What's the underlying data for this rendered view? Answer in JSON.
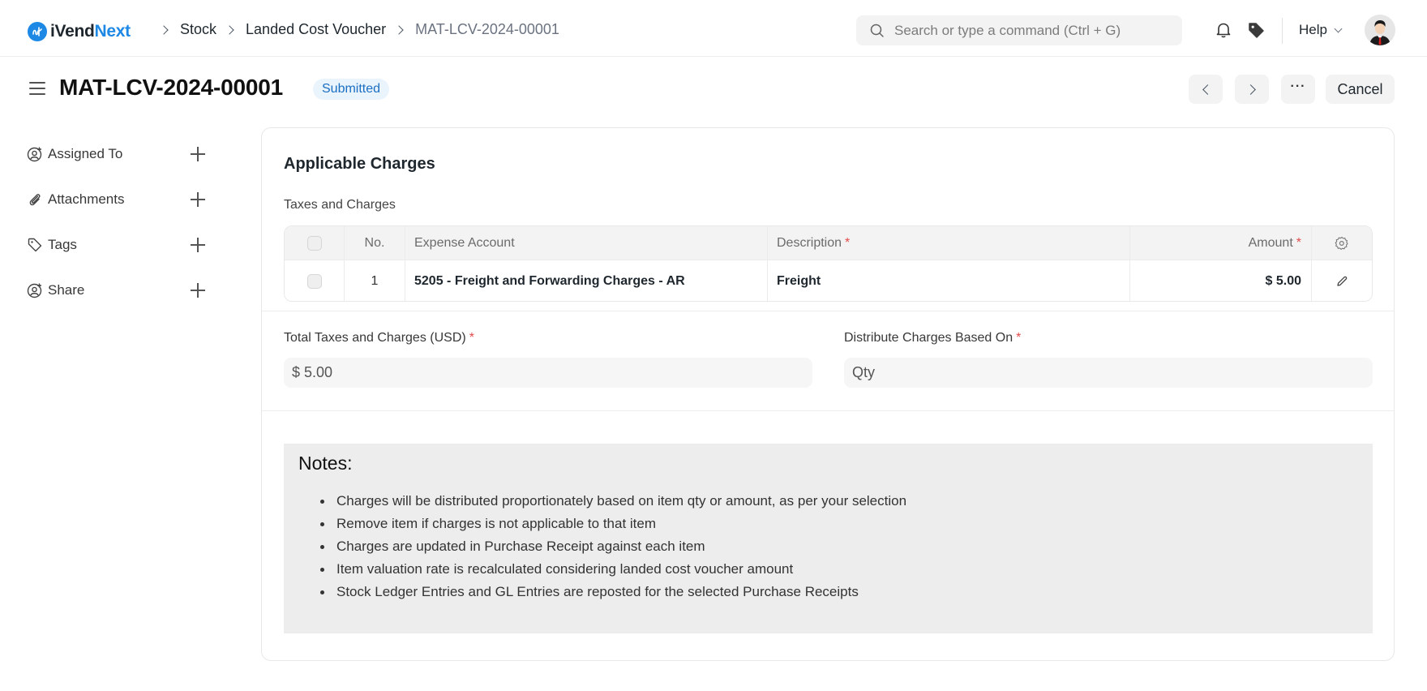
{
  "app": {
    "name_part1": "iVend",
    "name_part2": "Next",
    "brand_color": "#1e88e5"
  },
  "breadcrumb": [
    {
      "label": "Stock"
    },
    {
      "label": "Landed Cost Voucher"
    },
    {
      "label": "MAT-LCV-2024-00001"
    }
  ],
  "search": {
    "placeholder": "Search or type a command (Ctrl + G)",
    "icon": "search-icon"
  },
  "navbar": {
    "notifications_icon": "bell-icon",
    "tags_icon": "tag-icon",
    "help_label": "Help",
    "avatar_icon": "user-avatar"
  },
  "page": {
    "title": "MAT-LCV-2024-00001",
    "status": "Submitted",
    "status_color": "#1b6fc2",
    "actions": {
      "prev_icon": "chevron-left-icon",
      "next_icon": "chevron-right-icon",
      "more_label": "···",
      "cancel_label": "Cancel"
    }
  },
  "sidebar": {
    "items": [
      {
        "label": "Assigned To",
        "icon": "user-plus-icon"
      },
      {
        "label": "Attachments",
        "icon": "paperclip-icon"
      },
      {
        "label": "Tags",
        "icon": "tag-icon"
      },
      {
        "label": "Share",
        "icon": "user-plus-icon"
      }
    ]
  },
  "form": {
    "section_title": "Applicable Charges",
    "table_label": "Taxes and Charges",
    "table": {
      "columns": [
        "No.",
        "Expense Account",
        "Description",
        "Amount"
      ],
      "required_marker": "*",
      "rows": [
        {
          "no": "1",
          "expense_account": "5205 - Freight and Forwarding Charges - AR",
          "description": "Freight",
          "amount": "$ 5.00"
        }
      ]
    },
    "total_label": "Total Taxes and Charges (USD)",
    "total_value": "$ 5.00",
    "distribute_label": "Distribute Charges Based On",
    "distribute_value": "Qty",
    "notes": {
      "title": "Notes:",
      "items": [
        "Charges will be distributed proportionately based on item qty or amount, as per your selection",
        "Remove item if charges is not applicable to that item",
        "Charges are updated in Purchase Receipt against each item",
        "Item valuation rate is recalculated considering landed cost voucher amount",
        "Stock Ledger Entries and GL Entries are reposted for the selected Purchase Receipts"
      ]
    }
  }
}
